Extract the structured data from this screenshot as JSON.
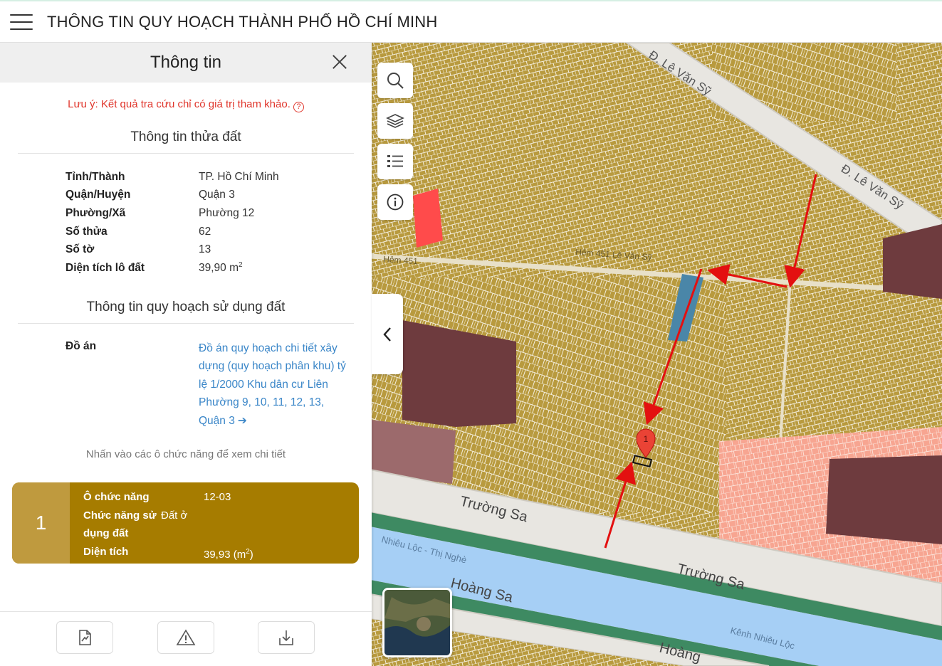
{
  "header": {
    "title": "THÔNG TIN QUY HOẠCH THÀNH PHỐ HỒ CHÍ MINH"
  },
  "panel": {
    "title": "Thông tin",
    "note": "Lưu ý: Kết quả tra cứu chỉ có giá trị tham khảo.",
    "parcel_section_title": "Thông tin thửa đất",
    "parcel": [
      {
        "key": "Tỉnh/Thành",
        "value": "TP. Hồ Chí Minh"
      },
      {
        "key": "Quận/Huyện",
        "value": "Quận 3"
      },
      {
        "key": "Phường/Xã",
        "value": "Phường 12"
      },
      {
        "key": "Số thửa",
        "value": "62"
      },
      {
        "key": "Số tờ",
        "value": "13"
      },
      {
        "key": "Diện tích lô đất",
        "value": "39,90 m",
        "unit_sup": "2"
      }
    ],
    "plan_section_title": "Thông tin quy hoạch sử dụng đất",
    "plan_key": "Đồ án",
    "plan_link": "Đồ án quy hoạch chi tiết xây dựng (quy hoạch phân khu) tỷ lệ 1/2000 Khu dân cư Liên Phường 9, 10, 11, 12, 13, Quận 3",
    "hint": "Nhấn vào các ô chức năng để xem chi tiết",
    "card": {
      "number": "1",
      "rows": [
        {
          "key": "Ô chức năng",
          "value": "12-03"
        },
        {
          "key": "Chức năng sử dụng đất",
          "value": "Đất ở"
        },
        {
          "key": "Diện tích",
          "value": "39,93 (m",
          "sup": "2",
          "suffix": ")"
        }
      ]
    }
  },
  "map": {
    "labels": {
      "le_van_sy_1": "Đ. Lê Văn Sỹ",
      "le_van_sy_2": "Đ. Lê Văn Sỹ",
      "hem_451": "Hẻm 451",
      "hem_451_le": "Hẻm 451 Lê Văn Sỹ",
      "truong_sa_1": "Trường Sa",
      "truong_sa_2": "Trường Sa",
      "hoang_sa_1": "Hoàng Sa",
      "hoang_sa_2": "Hoàng",
      "kenh_1": "Nhiêu Lộc - Thị Nghè",
      "kenh_2": "Kênh Nhiêu Lộc"
    },
    "marker_label": "1",
    "colors": {
      "residential": "#b89a3e",
      "commercial": "#6e3b3e",
      "public": "#f7a591",
      "water": "#a6cff5",
      "road": "#e8e6e1",
      "highlight": "#ff4b4b",
      "arrow": "#e31010",
      "park": "#4a86a8"
    }
  },
  "tools": [
    "search-icon",
    "layers-icon",
    "list-icon",
    "info-icon"
  ],
  "footer_buttons": [
    "document-icon",
    "warning-icon",
    "download-icon"
  ]
}
